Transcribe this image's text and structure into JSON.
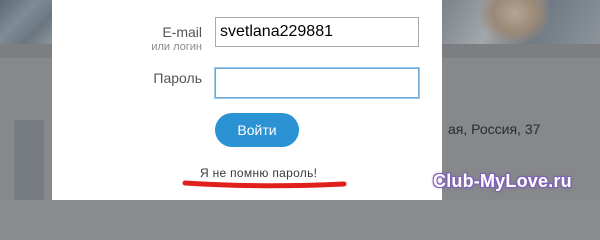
{
  "background": {
    "location_text": "ая, Россия, 37"
  },
  "login_form": {
    "email_label": "E-mail",
    "email_sublabel": "или логин",
    "login_value": "svetlana229881",
    "password_label": "Пароль",
    "password_value": "",
    "submit_label": "Войти",
    "forgot_password_label": "Я не помню пароль!"
  },
  "annotation": {
    "underline_color": "#e0201a"
  },
  "watermark": {
    "text": "Club-MyLove.ru",
    "color": "#ffffff",
    "outline_color": "#7f62b8"
  },
  "colors": {
    "button": "#2b92d3",
    "focus_border": "#6fa9d8",
    "overlay": "#808285"
  }
}
